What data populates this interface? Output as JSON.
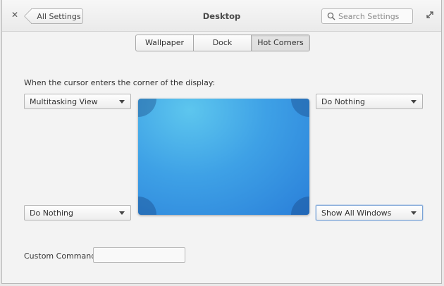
{
  "window": {
    "title": "Desktop",
    "back_label": "All Settings",
    "search_placeholder": "Search Settings"
  },
  "tabs": [
    {
      "label": "Wallpaper",
      "active": false
    },
    {
      "label": "Dock",
      "active": false
    },
    {
      "label": "Hot Corners",
      "active": true
    }
  ],
  "hot_corners": {
    "instruction": "When the cursor enters the corner of the display:",
    "top_left": "Multitasking View",
    "top_right": "Do Nothing",
    "bottom_left": "Do Nothing",
    "bottom_right": "Show All Windows",
    "custom_command_label": "Custom Command:",
    "custom_command_value": ""
  },
  "icons": {
    "close": "close-icon",
    "back": "back-arrow-icon",
    "search": "search-icon",
    "maximize": "maximize-icon"
  },
  "colors": {
    "display_light": "#5dc6ee",
    "display_dark": "#2a7fd9",
    "focus_border": "#7aa3d6"
  }
}
